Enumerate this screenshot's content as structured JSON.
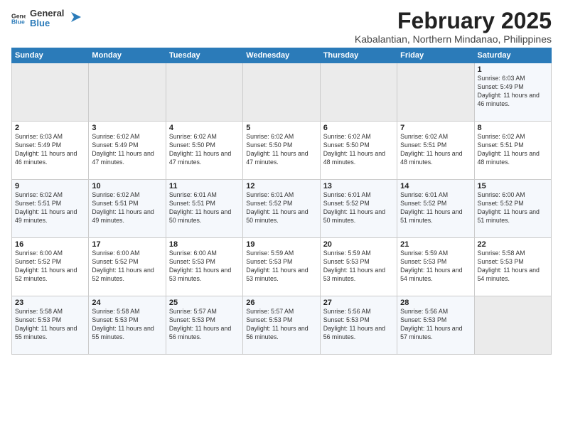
{
  "logo": {
    "general": "General",
    "blue": "Blue"
  },
  "title": "February 2025",
  "subtitle": "Kabalantian, Northern Mindanao, Philippines",
  "weekdays": [
    "Sunday",
    "Monday",
    "Tuesday",
    "Wednesday",
    "Thursday",
    "Friday",
    "Saturday"
  ],
  "weeks": [
    [
      {
        "day": "",
        "sunrise": "",
        "sunset": "",
        "daylight": ""
      },
      {
        "day": "",
        "sunrise": "",
        "sunset": "",
        "daylight": ""
      },
      {
        "day": "",
        "sunrise": "",
        "sunset": "",
        "daylight": ""
      },
      {
        "day": "",
        "sunrise": "",
        "sunset": "",
        "daylight": ""
      },
      {
        "day": "",
        "sunrise": "",
        "sunset": "",
        "daylight": ""
      },
      {
        "day": "",
        "sunrise": "",
        "sunset": "",
        "daylight": ""
      },
      {
        "day": "1",
        "sunrise": "Sunrise: 6:03 AM",
        "sunset": "Sunset: 5:49 PM",
        "daylight": "Daylight: 11 hours and 46 minutes."
      }
    ],
    [
      {
        "day": "2",
        "sunrise": "Sunrise: 6:03 AM",
        "sunset": "Sunset: 5:49 PM",
        "daylight": "Daylight: 11 hours and 46 minutes."
      },
      {
        "day": "3",
        "sunrise": "Sunrise: 6:02 AM",
        "sunset": "Sunset: 5:49 PM",
        "daylight": "Daylight: 11 hours and 47 minutes."
      },
      {
        "day": "4",
        "sunrise": "Sunrise: 6:02 AM",
        "sunset": "Sunset: 5:50 PM",
        "daylight": "Daylight: 11 hours and 47 minutes."
      },
      {
        "day": "5",
        "sunrise": "Sunrise: 6:02 AM",
        "sunset": "Sunset: 5:50 PM",
        "daylight": "Daylight: 11 hours and 47 minutes."
      },
      {
        "day": "6",
        "sunrise": "Sunrise: 6:02 AM",
        "sunset": "Sunset: 5:50 PM",
        "daylight": "Daylight: 11 hours and 48 minutes."
      },
      {
        "day": "7",
        "sunrise": "Sunrise: 6:02 AM",
        "sunset": "Sunset: 5:51 PM",
        "daylight": "Daylight: 11 hours and 48 minutes."
      },
      {
        "day": "8",
        "sunrise": "Sunrise: 6:02 AM",
        "sunset": "Sunset: 5:51 PM",
        "daylight": "Daylight: 11 hours and 48 minutes."
      }
    ],
    [
      {
        "day": "9",
        "sunrise": "Sunrise: 6:02 AM",
        "sunset": "Sunset: 5:51 PM",
        "daylight": "Daylight: 11 hours and 49 minutes."
      },
      {
        "day": "10",
        "sunrise": "Sunrise: 6:02 AM",
        "sunset": "Sunset: 5:51 PM",
        "daylight": "Daylight: 11 hours and 49 minutes."
      },
      {
        "day": "11",
        "sunrise": "Sunrise: 6:01 AM",
        "sunset": "Sunset: 5:51 PM",
        "daylight": "Daylight: 11 hours and 50 minutes."
      },
      {
        "day": "12",
        "sunrise": "Sunrise: 6:01 AM",
        "sunset": "Sunset: 5:52 PM",
        "daylight": "Daylight: 11 hours and 50 minutes."
      },
      {
        "day": "13",
        "sunrise": "Sunrise: 6:01 AM",
        "sunset": "Sunset: 5:52 PM",
        "daylight": "Daylight: 11 hours and 50 minutes."
      },
      {
        "day": "14",
        "sunrise": "Sunrise: 6:01 AM",
        "sunset": "Sunset: 5:52 PM",
        "daylight": "Daylight: 11 hours and 51 minutes."
      },
      {
        "day": "15",
        "sunrise": "Sunrise: 6:00 AM",
        "sunset": "Sunset: 5:52 PM",
        "daylight": "Daylight: 11 hours and 51 minutes."
      }
    ],
    [
      {
        "day": "16",
        "sunrise": "Sunrise: 6:00 AM",
        "sunset": "Sunset: 5:52 PM",
        "daylight": "Daylight: 11 hours and 52 minutes."
      },
      {
        "day": "17",
        "sunrise": "Sunrise: 6:00 AM",
        "sunset": "Sunset: 5:52 PM",
        "daylight": "Daylight: 11 hours and 52 minutes."
      },
      {
        "day": "18",
        "sunrise": "Sunrise: 6:00 AM",
        "sunset": "Sunset: 5:53 PM",
        "daylight": "Daylight: 11 hours and 53 minutes."
      },
      {
        "day": "19",
        "sunrise": "Sunrise: 5:59 AM",
        "sunset": "Sunset: 5:53 PM",
        "daylight": "Daylight: 11 hours and 53 minutes."
      },
      {
        "day": "20",
        "sunrise": "Sunrise: 5:59 AM",
        "sunset": "Sunset: 5:53 PM",
        "daylight": "Daylight: 11 hours and 53 minutes."
      },
      {
        "day": "21",
        "sunrise": "Sunrise: 5:59 AM",
        "sunset": "Sunset: 5:53 PM",
        "daylight": "Daylight: 11 hours and 54 minutes."
      },
      {
        "day": "22",
        "sunrise": "Sunrise: 5:58 AM",
        "sunset": "Sunset: 5:53 PM",
        "daylight": "Daylight: 11 hours and 54 minutes."
      }
    ],
    [
      {
        "day": "23",
        "sunrise": "Sunrise: 5:58 AM",
        "sunset": "Sunset: 5:53 PM",
        "daylight": "Daylight: 11 hours and 55 minutes."
      },
      {
        "day": "24",
        "sunrise": "Sunrise: 5:58 AM",
        "sunset": "Sunset: 5:53 PM",
        "daylight": "Daylight: 11 hours and 55 minutes."
      },
      {
        "day": "25",
        "sunrise": "Sunrise: 5:57 AM",
        "sunset": "Sunset: 5:53 PM",
        "daylight": "Daylight: 11 hours and 56 minutes."
      },
      {
        "day": "26",
        "sunrise": "Sunrise: 5:57 AM",
        "sunset": "Sunset: 5:53 PM",
        "daylight": "Daylight: 11 hours and 56 minutes."
      },
      {
        "day": "27",
        "sunrise": "Sunrise: 5:56 AM",
        "sunset": "Sunset: 5:53 PM",
        "daylight": "Daylight: 11 hours and 56 minutes."
      },
      {
        "day": "28",
        "sunrise": "Sunrise: 5:56 AM",
        "sunset": "Sunset: 5:53 PM",
        "daylight": "Daylight: 11 hours and 57 minutes."
      },
      {
        "day": "",
        "sunrise": "",
        "sunset": "",
        "daylight": ""
      }
    ]
  ]
}
